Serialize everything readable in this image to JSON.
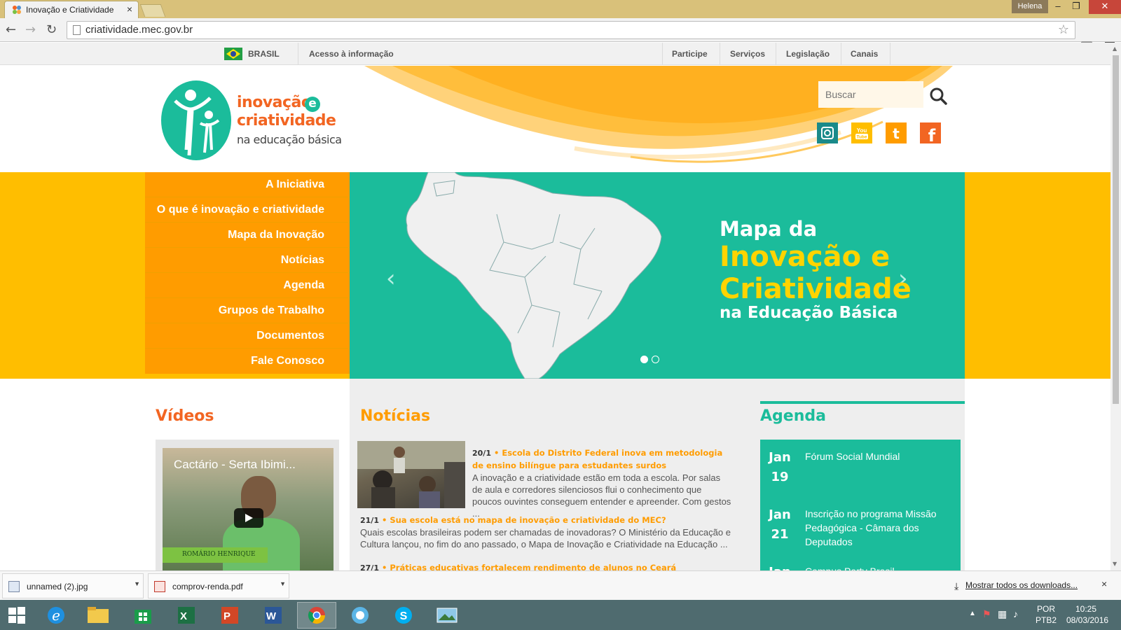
{
  "browser": {
    "tab_title": "Inovação e Criatividade",
    "tab_close": "×",
    "user": "Helena",
    "url": "criatividade.mec.gov.br",
    "window_controls": {
      "minimize": "–",
      "restore": "❐",
      "close": "✕"
    }
  },
  "govbar": {
    "country": "BRASIL",
    "access": "Acesso à informação",
    "links": [
      "Participe",
      "Serviços",
      "Legislação",
      "Canais"
    ]
  },
  "header": {
    "logo_line1": "inovação",
    "logo_e": "e",
    "logo_line2": "criatividade",
    "logo_line3": "na educação básica",
    "search_placeholder": "Buscar",
    "social": [
      {
        "name": "instagram",
        "color": "#1a8a8a",
        "glyph": "◎"
      },
      {
        "name": "youtube",
        "color": "#ffbe00",
        "glyph": "You Tube"
      },
      {
        "name": "twitter",
        "color": "#ff9c00",
        "glyph": "t"
      },
      {
        "name": "facebook",
        "color": "#f26522",
        "glyph": "f"
      }
    ]
  },
  "menu": {
    "items": [
      "A Iniciativa",
      "O que é inovação e criatividade",
      "Mapa da Inovação",
      "Notícias",
      "Agenda",
      "Grupos de Trabalho",
      "Documentos",
      "Fale Conosco"
    ]
  },
  "slider": {
    "line1": "Mapa da",
    "line2a": "Inovação e",
    "line2b": "Criatividade",
    "line3": "na Educação Básica",
    "prev": "‹",
    "next": "›",
    "active_slide": 1,
    "slide_count": 2
  },
  "videos": {
    "title": "Vídeos",
    "video_title": "Cactário - Serta Ibimi...",
    "lower_third": "ROMÁRIO HENRIQUE"
  },
  "news": {
    "title": "Notícias",
    "items": [
      {
        "date": "20/1",
        "title": " • Escola do Distrito Federal inova em metodologia de ensino bilíngue para estudantes surdos",
        "body": "A inovação e a criatividade estão em toda a escola. Por salas de aula e corredores silenciosos flui o conhecimento que poucos ouvintes conseguem entender e apreender. Com gestos ..."
      },
      {
        "date": "21/1",
        "title": " • Sua escola está no mapa de inovação e criatividade do MEC?",
        "body": "Quais escolas brasileiras podem ser chamadas de inovadoras? O Ministério da Educação e Cultura lançou, no fim do ano passado, o Mapa de Inovação e Criatividade na Educação ..."
      },
      {
        "date": "27/1",
        "title": " • Práticas educativas fortalecem rendimento de alunos no Ceará",
        "body": ""
      }
    ]
  },
  "agenda": {
    "title": "Agenda",
    "items": [
      {
        "month": "Jan",
        "day": "19",
        "text": "Fórum Social Mundial"
      },
      {
        "month": "Jan",
        "day": "21",
        "text": "Inscrição no programa Missão Pedagógica - Câmara dos Deputados"
      },
      {
        "month": "Jan",
        "day": "",
        "text": "Campus Party Brasil"
      }
    ]
  },
  "downloads": {
    "files": [
      "unnamed (2).jpg",
      "comprov-renda.pdf"
    ],
    "show_all": "Mostrar todos os downloads...",
    "close": "×"
  },
  "taskbar": {
    "lang1": "POR",
    "lang2": "PTB2",
    "time": "10:25",
    "date": "08/03/2016"
  },
  "colors": {
    "teal": "#1bbc9b",
    "orange": "#ff9c00",
    "yellow": "#ffbe00",
    "title_orange": "#f26522"
  }
}
